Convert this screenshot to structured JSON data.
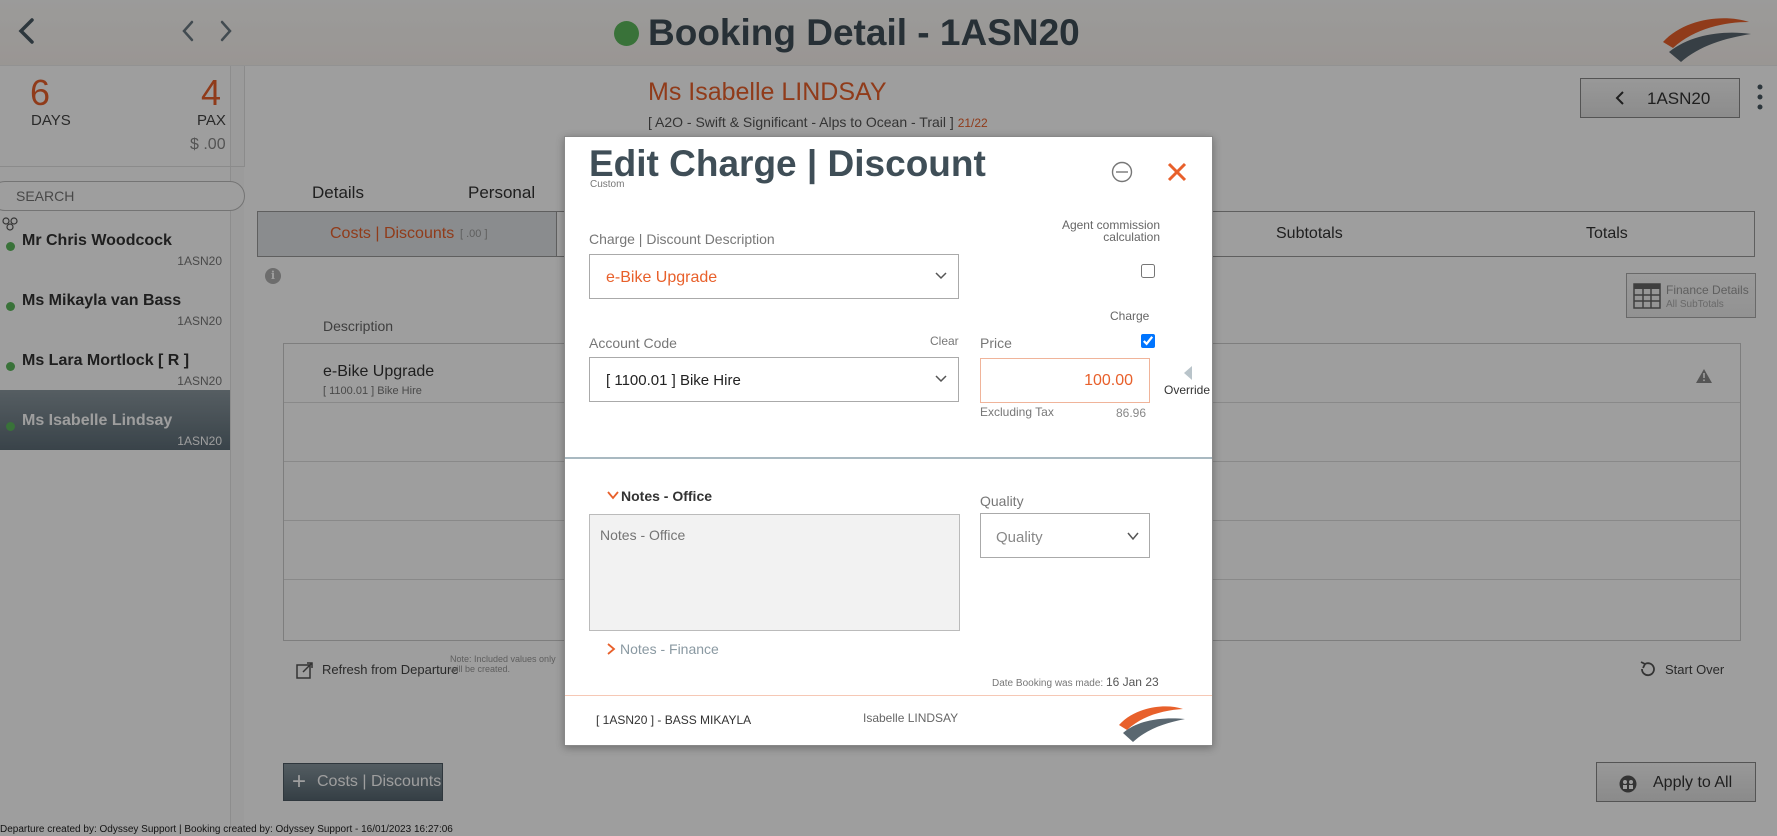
{
  "header": {
    "title": "Booking Detail - 1ASN20",
    "status_color": "#5cb85c",
    "back_icon": "chevron-left-icon",
    "prev_icon": "chevron-left-icon",
    "next_icon": "chevron-right-icon"
  },
  "stats": {
    "days_value": "6",
    "days_label": "DAYS",
    "pax_value": "4",
    "pax_label": "PAX",
    "amount": "$ .00"
  },
  "search": {
    "placeholder": "SEARCH"
  },
  "passengers": [
    {
      "name": "Mr Chris Woodcock",
      "code": "1ASN20",
      "active": false
    },
    {
      "name": "Ms Mikayla van Bass",
      "code": "1ASN20",
      "active": false
    },
    {
      "name": "Ms Lara Mortlock  [ R ]",
      "code": "1ASN20",
      "active": false
    },
    {
      "name": "Ms Isabelle Lindsay",
      "code": "1ASN20",
      "active": true
    }
  ],
  "guest": {
    "name": "Ms Isabelle LINDSAY",
    "trip": "[ A2O - Swift & Significant - Alps to Ocean - Trail ]",
    "trip_year": "21/22",
    "booking_button": "1ASN20"
  },
  "tabs": [
    "Details",
    "Personal"
  ],
  "subtabs": {
    "costs_label": "Costs | Discounts",
    "costs_amount": "[ .00 ]",
    "subtotals": "Subtotals",
    "totals": "Totals"
  },
  "finance_details": {
    "title": "Finance Details",
    "subtitle": "All SubTotals"
  },
  "table": {
    "column_description": "Description",
    "rows": [
      {
        "description": "e-Bike Upgrade",
        "account": "[ 1100.01 ]  Bike Hire"
      }
    ]
  },
  "actions": {
    "refresh": "Refresh from Departure",
    "refresh_note": "Note: Included values only will be created.",
    "start_over": "Start Over",
    "add_costs": "Costs | Discounts",
    "apply_all": "Apply to All"
  },
  "footer": "Departure created by: Odyssey Support | Booking created by: Odyssey Support - 16/01/2023 16:27:06",
  "modal": {
    "title": "Edit Charge | Discount",
    "subtitle": "Custom",
    "description_label": "Charge | Discount Description",
    "description_value": "e-Bike Upgrade",
    "agent_commission_label": "Agent commission calculation",
    "agent_commission_checked": false,
    "account_label": "Account Code",
    "clear_label": "Clear",
    "account_value": "[ 1100.01 ]  Bike Hire",
    "charge_label": "Charge",
    "charge_checked": true,
    "price_label": "Price",
    "price_value": "100.00",
    "override_label": "Override",
    "excluding_tax_label": "Excluding Tax",
    "excluding_tax_value": "86.96",
    "notes_office_title": "Notes - Office",
    "notes_office_placeholder": "Notes - Office",
    "quality_label": "Quality",
    "quality_placeholder": "Quality",
    "notes_finance_title": "Notes - Finance",
    "date_made_label": "Date Booking was made:",
    "date_made_value": "16 Jan 23",
    "footer_left": "[ 1ASN20 ] - BASS MIKAYLA",
    "footer_mid": "Isabelle LINDSAY"
  },
  "colors": {
    "accent": "#e8602b",
    "heading": "#3f4e57",
    "active_item": "#6b7a83"
  }
}
